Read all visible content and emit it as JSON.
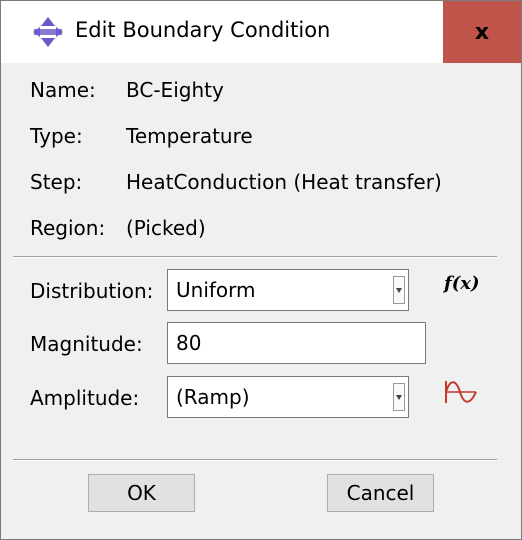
{
  "window": {
    "title": "Edit Boundary Condition",
    "close_label": "x"
  },
  "info": {
    "name_label": "Name:",
    "name_value": "BC-Eighty",
    "type_label": "Type:",
    "type_value": "Temperature",
    "step_label": "Step:",
    "step_value": "HeatConduction (Heat transfer)",
    "region_label": "Region:",
    "region_value": "(Picked)"
  },
  "form": {
    "distribution_label": "Distribution:",
    "distribution_value": "Uniform",
    "fx_label": "f(x)",
    "magnitude_label": "Magnitude:",
    "magnitude_value": "80",
    "amplitude_label": "Amplitude:",
    "amplitude_value": "(Ramp)"
  },
  "buttons": {
    "ok": "OK",
    "cancel": "Cancel"
  },
  "colors": {
    "close_bg": "#c0544b",
    "icon_accent": "#6a5acd",
    "wave": "#c0392b"
  },
  "icons": [
    "app-icon",
    "close-icon",
    "dropdown-arrow-icon",
    "function-icon",
    "amplitude-wave-icon"
  ]
}
